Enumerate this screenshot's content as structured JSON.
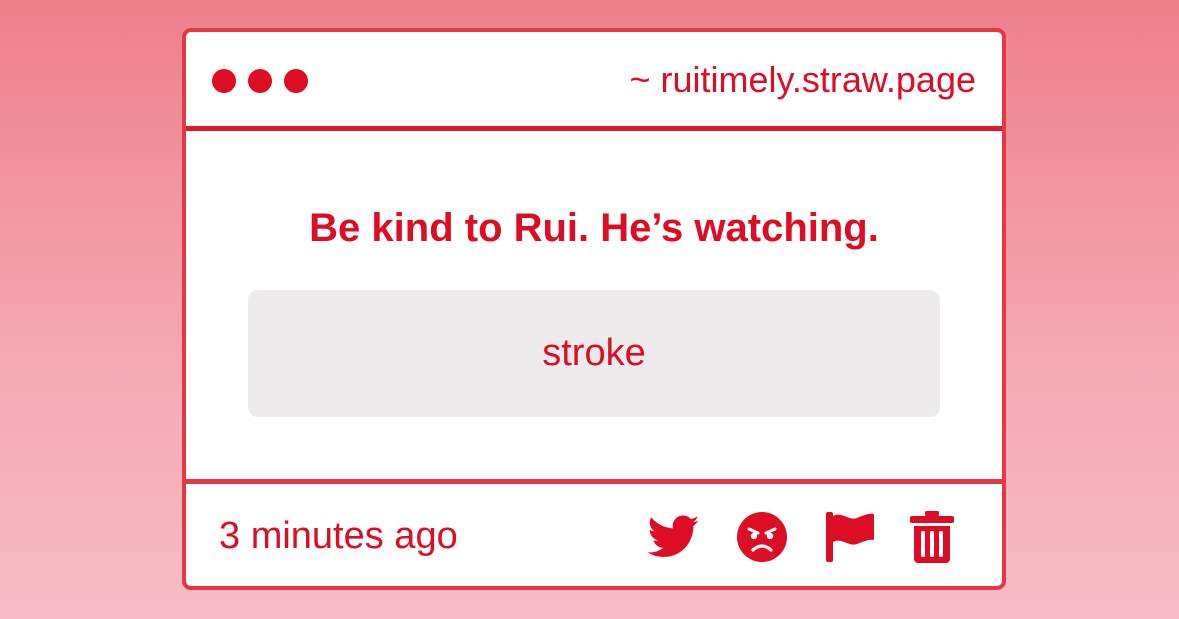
{
  "window": {
    "url": "~ ruitimely.straw.page"
  },
  "post": {
    "question": "Be kind to Rui. He’s watching.",
    "answer": "stroke"
  },
  "footer": {
    "timestamp": "3 minutes ago",
    "icons": [
      "twitter-icon",
      "angry-face-icon",
      "flag-icon",
      "trash-icon"
    ]
  },
  "colors": {
    "accent": "#dc0d24",
    "border": "#e43846",
    "answer_bg": "#edebec",
    "background_top": "#ee7f8b",
    "background_bottom": "#f6bcc5"
  }
}
